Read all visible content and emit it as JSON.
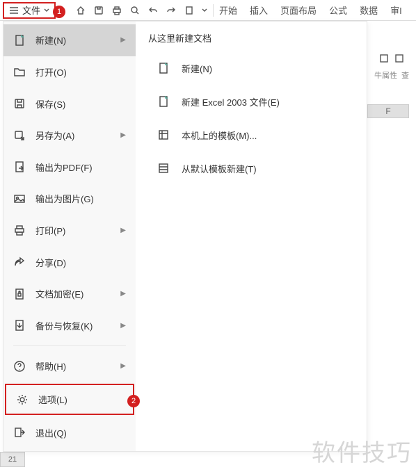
{
  "toolbar": {
    "file_label": "文件",
    "badge1": "1",
    "tabs": [
      "开始",
      "插入",
      "页面布局",
      "公式",
      "数据",
      "审I"
    ]
  },
  "ribbon": {
    "props": "牛属性",
    "view": "查"
  },
  "menu": {
    "items": [
      {
        "label": "新建(N)",
        "icon": "file-new-icon",
        "arrow": true,
        "selected": true
      },
      {
        "label": "打开(O)",
        "icon": "folder-open-icon"
      },
      {
        "label": "保存(S)",
        "icon": "save-icon"
      },
      {
        "label": "另存为(A)",
        "icon": "save-as-icon",
        "arrow": true
      },
      {
        "label": "输出为PDF(F)",
        "icon": "export-pdf-icon"
      },
      {
        "label": "输出为图片(G)",
        "icon": "export-image-icon"
      },
      {
        "label": "打印(P)",
        "icon": "print-icon",
        "arrow": true
      },
      {
        "label": "分享(D)",
        "icon": "share-icon"
      },
      {
        "label": "文档加密(E)",
        "icon": "encrypt-icon",
        "arrow": true
      },
      {
        "label": "备份与恢复(K)",
        "icon": "backup-icon",
        "arrow": true
      },
      {
        "label": "帮助(H)",
        "icon": "help-icon",
        "arrow": true
      },
      {
        "label": "选项(L)",
        "icon": "settings-icon",
        "options": true,
        "badge": "2"
      },
      {
        "label": "退出(Q)",
        "icon": "exit-icon"
      }
    ],
    "right_title": "从这里新建文档",
    "sub": [
      {
        "label": "新建(N)",
        "icon": "file-new-icon"
      },
      {
        "label": "新建 Excel 2003 文件(E)",
        "icon": "file-xls-icon"
      },
      {
        "label": "本机上的模板(M)...",
        "icon": "template-local-icon"
      },
      {
        "label": "从默认模板新建(T)",
        "icon": "template-default-icon"
      }
    ]
  },
  "sheet": {
    "row": "21",
    "colF": "F"
  },
  "watermark": "软件技巧"
}
